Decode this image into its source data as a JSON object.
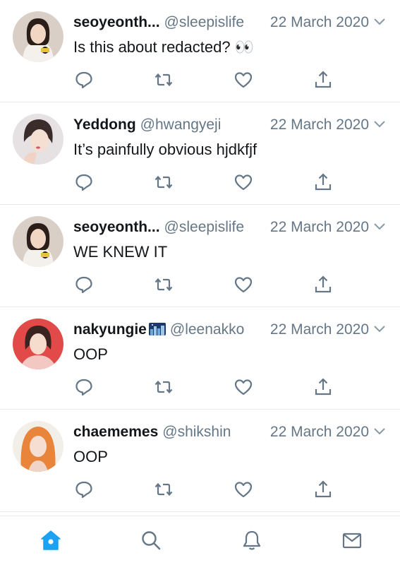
{
  "colors": {
    "accent": "#1da1f2",
    "icon_gray": "#657786",
    "divider": "#e6ecf0",
    "text": "#14171a"
  },
  "tweets": [
    {
      "name": "seoyeonth...",
      "handle": "@sleepislife",
      "date": "22 March 2020",
      "text": "Is this about redacted? 👀",
      "avatar_icon": "profile-photo-woman"
    },
    {
      "name": "Yeddong",
      "handle": "@hwangyeji",
      "date": "22 March 2020",
      "text": "It’s painfully obvious hjdkfjf",
      "avatar_icon": "profile-photo-woman"
    },
    {
      "name": "seoyeonth...",
      "handle": "@sleepislife",
      "date": "22 March 2020",
      "text": "WE KNEW IT",
      "avatar_icon": "profile-photo-woman"
    },
    {
      "name": "nakyungie",
      "handle": "@leenakko",
      "date": "22 March 2020",
      "text": "OOP",
      "avatar_icon": "profile-photo-woman",
      "name_emoji": "night-city-emoji"
    },
    {
      "name": "chaememes",
      "handle": "@shikshin",
      "date": "22 March 2020",
      "text": "OOP",
      "avatar_icon": "profile-photo-woman"
    }
  ],
  "tabbar": {
    "items": [
      "home-icon",
      "search-icon",
      "notifications-icon",
      "messages-icon"
    ],
    "active": "home-icon"
  }
}
